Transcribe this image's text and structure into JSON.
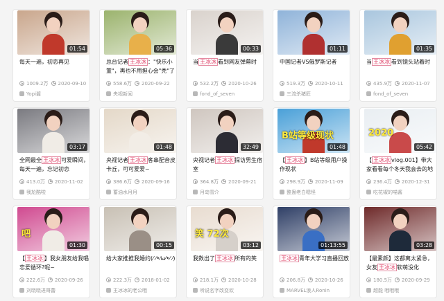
{
  "videos": [
    {
      "title_pre": "每天一遍，初恋再见",
      "highlight": "",
      "title_post": "",
      "duration": "01:54",
      "views": "1009.2万",
      "date": "2020-09-10",
      "uploader": "Yopi酱",
      "thumb_bg": "#c9a68c",
      "shirt": "#c0392b",
      "overlay": ""
    },
    {
      "title_pre": "总台记者",
      "highlight": "王冰冰",
      "title_post": "：\"快乐小董\"，再也不用担心会\"秃\"了",
      "duration": "05:36",
      "views": "558.6万",
      "date": "2020-09-22",
      "uploader": "央视新闻",
      "thumb_bg": "#9bb36d",
      "shirt": "#e8b04a",
      "overlay": ""
    },
    {
      "title_pre": "当",
      "highlight": "王冰冰",
      "title_post": "看到网友弹幕时",
      "duration": "00:33",
      "views": "532.2万",
      "date": "2020-10-26",
      "uploader": "fond_of_seven",
      "thumb_bg": "#d9d2cc",
      "shirt": "#3a3a3a",
      "overlay": ""
    },
    {
      "title_pre": "中国记者VS俄罗斯记者",
      "highlight": "",
      "title_post": "",
      "duration": "01:11",
      "views": "519.3万",
      "date": "2020-10-11",
      "uploader": "三流杀猪匠",
      "thumb_bg": "#8fb3d9",
      "shirt": "#b03030",
      "overlay": ""
    },
    {
      "title_pre": "当",
      "highlight": "王冰冰",
      "title_post": "看到镜头站着时",
      "duration": "01:35",
      "views": "435.9万",
      "date": "2020-11-07",
      "uploader": "fond_of_seven",
      "thumb_bg": "#a9c6de",
      "shirt": "#e0a030",
      "overlay": ""
    },
    {
      "title_pre": "全网最全",
      "highlight": "王冰冰",
      "title_post": "可爱瞬间，每天一遍，忘记初恋",
      "duration": "03:17",
      "views": "413.0万",
      "date": "2020-11-02",
      "uploader": "我尬酷啦",
      "thumb_bg": "#7a7a80",
      "shirt": "#f0ece6",
      "overlay": ""
    },
    {
      "title_pre": "央视记者",
      "highlight": "王冰冰",
      "title_post": "客串配音皮卡丘，可可爱爱~",
      "duration": "01:48",
      "views": "386.6万",
      "date": "2020-09-16",
      "uploader": "蓄油水月月",
      "thumb_bg": "#e4d8c8",
      "shirt": "#f2ede6",
      "overlay": ""
    },
    {
      "title_pre": "央视记者",
      "highlight": "王冰冰",
      "title_post": "探访男生宿室",
      "duration": "32:49",
      "views": "364.8万",
      "date": "2020-09-21",
      "uploader": "月岛雪介",
      "thumb_bg": "#cfc6bf",
      "shirt": "#2c2c34",
      "overlay": ""
    },
    {
      "title_pre": "【",
      "highlight": "王冰冰",
      "title_post": "】B站等级用户操作现状",
      "duration": "01:48",
      "views": "298.9万",
      "date": "2020-11-09",
      "uploader": "整蛊老白嗯怪",
      "thumb_bg": "#4aa0d8",
      "shirt": "#c0392b",
      "overlay": "B站等级现状"
    },
    {
      "title_pre": "【",
      "highlight": "王冰冰",
      "title_post": "vlog.001】带大家看看每个冬天我会去的地方",
      "duration": "05:42",
      "views": "236.4万",
      "date": "2020-12-31",
      "uploader": "吃花椒的喵酱",
      "thumb_bg": "#e9eef2",
      "shirt": "#c94a4a",
      "overlay": "2020"
    },
    {
      "title_pre": "【",
      "highlight": "王冰冰",
      "title_post": "】我女朋友给我唱恋爱循环?呢~",
      "duration": "01:30",
      "views": "222.6万",
      "date": "2020-09-26",
      "uploader": "刘晓晓进哥蕾",
      "thumb_bg": "#d04a90",
      "shirt": "#f0ece6",
      "overlay": "吧"
    },
    {
      "title_pre": "给大家推推我婚约(⁄ ⁄•⁄ω⁄•⁄ ⁄)",
      "highlight": "",
      "title_post": "",
      "duration": "00:15",
      "views": "222.3万",
      "date": "2018-01-02",
      "uploader": "王冰冰的老公哦",
      "thumb_bg": "#c8c0b4",
      "shirt": "#9a8f86",
      "overlay": ""
    },
    {
      "title_pre": "我数出了",
      "highlight": "王冰冰",
      "title_post": "所有的笑",
      "duration": "03:12",
      "views": "218.1万",
      "date": "2020-10-28",
      "uploader": "听说名字改变欢",
      "thumb_bg": "#e8dcd0",
      "shirt": "#d6d0ca",
      "overlay": "笑 72次"
    },
    {
      "title_pre": "",
      "highlight": "王冰冰",
      "title_post": "青年大学习直播回放",
      "duration": "01:13:55",
      "views": "206.8万",
      "date": "2020-10-26",
      "uploader": "MARVEL浪人Ronin",
      "thumb_bg": "#2f3f66",
      "shirt": "#3a6fc4",
      "overlay": ""
    },
    {
      "title_pre": "【最素颜】这都离太紧急，女友",
      "highlight": "王冰冰",
      "title_post": "软萌没化",
      "duration": "03:28",
      "views": "180.5万",
      "date": "2020-09-29",
      "uploader": "超能 哦哦哦",
      "thumb_bg": "#6e2a2a",
      "shirt": "#1e2a3a",
      "overlay": ""
    }
  ]
}
